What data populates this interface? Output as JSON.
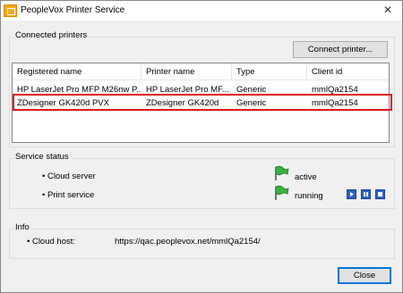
{
  "window": {
    "title": "PeopleVox Printer Service",
    "app_icon": "peoplevox-logo-icon",
    "close_icon": "close-icon",
    "close_glyph": "✕"
  },
  "printers": {
    "group_label": "Connected printers",
    "connect_button": "Connect printer...",
    "columns": [
      "Registered name",
      "Printer name",
      "Type",
      "Client id"
    ],
    "rows": [
      {
        "registered_name": "HP LaserJet Pro MFP M26nw P...",
        "printer_name": "HP LaserJet Pro MF...",
        "type": "Generic",
        "client_id": "mmlQa2154"
      },
      {
        "registered_name": "ZDesigner GK420d PVX",
        "printer_name": "ZDesigner GK420d",
        "type": "Generic",
        "client_id": "mmlQa2154",
        "highlighted": true
      }
    ],
    "highlight_color": "#e0161e"
  },
  "service_status": {
    "group_label": "Service status",
    "items": [
      {
        "label": "• Cloud server",
        "status": "active",
        "icon": "green-flag-icon"
      },
      {
        "label": "• Print service",
        "status": "running",
        "icon": "green-flag-icon"
      }
    ],
    "controls": [
      "play-icon",
      "pause-icon",
      "stop-icon"
    ],
    "accent": "#2e63c7"
  },
  "info": {
    "group_label": "Info",
    "cloud_host_label": "• Cloud host:",
    "cloud_host_value": "https://qac.peoplevox.net/mmlQa2154/"
  },
  "footer": {
    "close_button": "Close"
  }
}
